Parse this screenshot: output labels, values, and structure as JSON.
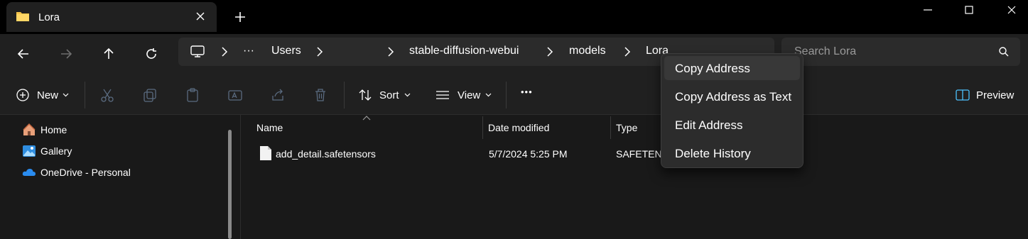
{
  "tab": {
    "title": "Lora"
  },
  "breadcrumb": {
    "overflow": "···",
    "items": [
      "Users",
      "stable-diffusion-webui",
      "models",
      "Lora"
    ]
  },
  "search": {
    "placeholder": "Search Lora"
  },
  "commandbar": {
    "new_label": "New",
    "sort_label": "Sort",
    "view_label": "View",
    "more_label": "•••",
    "preview_label": "Preview"
  },
  "navpane": {
    "items": [
      {
        "label": "Home",
        "icon": "home-icon"
      },
      {
        "label": "Gallery",
        "icon": "gallery-icon"
      },
      {
        "label": "OneDrive - Personal",
        "icon": "onedrive-icon"
      }
    ]
  },
  "filelist": {
    "columns": [
      "Name",
      "Date modified",
      "Type"
    ],
    "rows": [
      {
        "name": "add_detail.safetensors",
        "date": "5/7/2024 5:25 PM",
        "type": "SAFETENSORS File"
      }
    ]
  },
  "context_menu": {
    "items": [
      "Copy Address",
      "Copy Address as Text",
      "Edit Address",
      "Delete History"
    ],
    "highlighted_index": 0
  },
  "colors": {
    "window_bg": "#191919",
    "toolbar_bg": "#202020",
    "titlebar_bg": "#000000",
    "accent": "#4cc2ff",
    "folder_yellow": "#f4c44a"
  }
}
